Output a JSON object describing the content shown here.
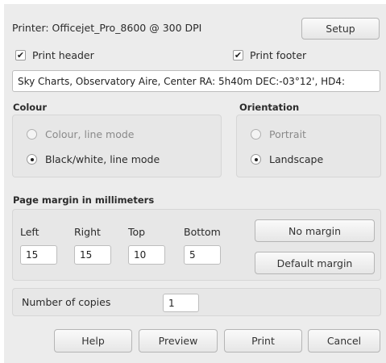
{
  "printer": {
    "label": "Printer: Officejet_Pro_8600 @ 300 DPI",
    "setup_label": "Setup"
  },
  "print_header": {
    "label": "Print header",
    "checked": true
  },
  "print_footer": {
    "label": "Print footer",
    "checked": true
  },
  "header_text": "Sky Charts, Observatory Aire, Center RA:  5h40m DEC:-03°12', HD4:",
  "colour": {
    "title": "Colour",
    "options": [
      {
        "label": "Colour, line mode",
        "selected": false
      },
      {
        "label": "Black/white, line mode",
        "selected": true
      }
    ]
  },
  "orientation": {
    "title": "Orientation",
    "options": [
      {
        "label": "Portrait",
        "selected": false
      },
      {
        "label": "Landscape",
        "selected": true
      }
    ]
  },
  "margins": {
    "title": "Page margin in millimeters",
    "left_label": "Left",
    "left_value": "15",
    "right_label": "Right",
    "right_value": "15",
    "top_label": "Top",
    "top_value": "10",
    "bottom_label": "Bottom",
    "bottom_value": "5",
    "no_margin_label": "No margin",
    "default_margin_label": "Default margin"
  },
  "copies": {
    "label": "Number of copies",
    "value": "1"
  },
  "buttons": {
    "help": "Help",
    "preview": "Preview",
    "print": "Print",
    "cancel": "Cancel"
  },
  "check_glyph": "✔"
}
